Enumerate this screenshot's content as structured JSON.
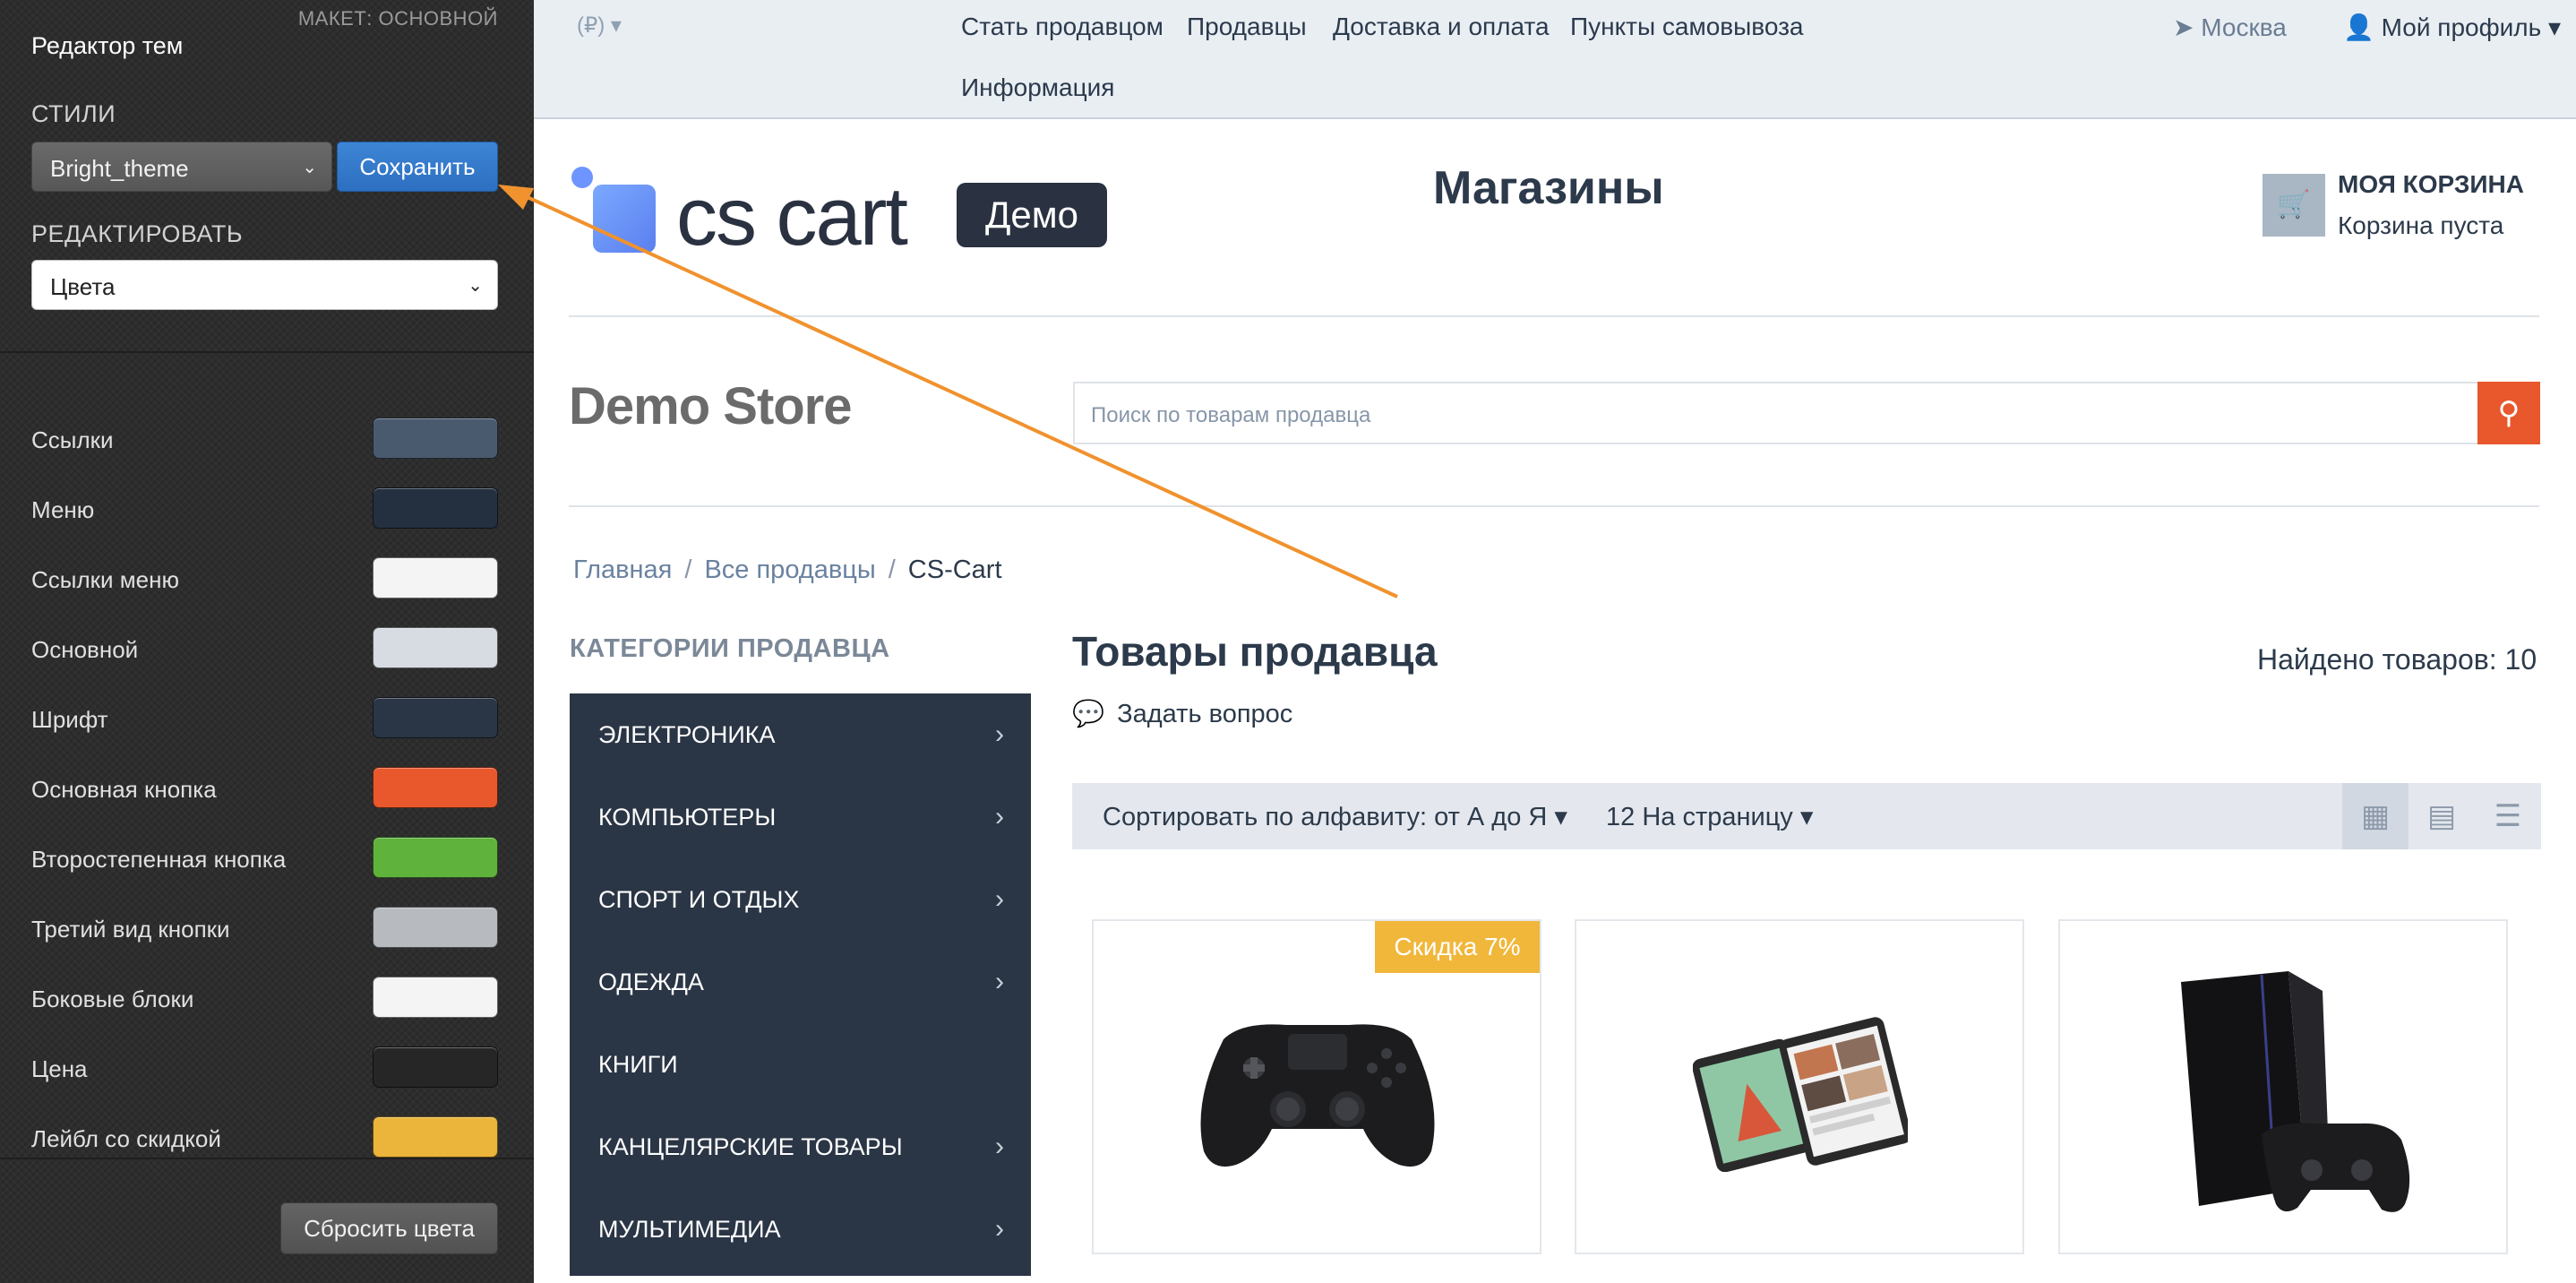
{
  "editor": {
    "layout_label": "МАКЕТ: ОСНОВНОЙ",
    "title": "Редактор тем",
    "styles_label": "СТИЛИ",
    "style_selected": "Bright_theme",
    "save_label": "Сохранить",
    "edit_label": "РЕДАКТИРОВАТЬ",
    "edit_selected": "Цвета",
    "colors": [
      {
        "label": "Ссылки",
        "color": "#4a5a6e"
      },
      {
        "label": "Меню",
        "color": "#243040"
      },
      {
        "label": "Ссылки меню",
        "color": "#f4f4f4"
      },
      {
        "label": "Основной",
        "color": "#d7dce2"
      },
      {
        "label": "Шрифт",
        "color": "#2a3545"
      },
      {
        "label": "Основная кнопка",
        "color": "#e8582c"
      },
      {
        "label": "Второстепенная кнопка",
        "color": "#5fb33c"
      },
      {
        "label": "Третий вид кнопки",
        "color": "#b7bbc0"
      },
      {
        "label": "Боковые блоки",
        "color": "#f4f4f4"
      },
      {
        "label": "Цена",
        "color": "#262626"
      },
      {
        "label": "Лейбл со скидкой",
        "color": "#eab53a"
      }
    ],
    "reset_label": "Сбросить цвета",
    "collapse_icon": "chevron-left-icon"
  },
  "topbar": {
    "currency": "(₽)",
    "nav": [
      "Стать продавцом",
      "Продавцы",
      "Доставка и оплата",
      "Пункты самовывоза",
      "Информация"
    ],
    "location": "Москва",
    "profile": "Мой профиль"
  },
  "header": {
    "logo_text": "cs cart",
    "logo_badge": "Демо",
    "page_title": "Магазины",
    "cart_title": "МОЯ КОРЗИНА",
    "cart_status": "Корзина пуста"
  },
  "store": {
    "logo_text": "Demo Store",
    "search_placeholder": "Поиск по товарам продавца"
  },
  "breadcrumb": [
    "Главная",
    "Все продавцы",
    "CS-Cart"
  ],
  "categories": {
    "heading": "КАТЕГОРИИ ПРОДАВЦА",
    "items": [
      {
        "label": "ЭЛЕКТРОНИКА",
        "has_children": true
      },
      {
        "label": "КОМПЬЮТЕРЫ",
        "has_children": true
      },
      {
        "label": "СПОРТ И ОТДЫХ",
        "has_children": true
      },
      {
        "label": "ОДЕЖДА",
        "has_children": true
      },
      {
        "label": "КНИГИ",
        "has_children": false
      },
      {
        "label": "КАНЦЕЛЯРСКИЕ ТОВАРЫ",
        "has_children": true
      },
      {
        "label": "МУЛЬТИМЕДИА",
        "has_children": true
      }
    ]
  },
  "products": {
    "title": "Товары продавца",
    "found": "Найдено товаров: 10",
    "ask": "Задать вопрос",
    "sort": "Сортировать по алфавиту: от А до Я",
    "per_page": "12 На страницу",
    "items": [
      {
        "image": "gamepad",
        "badge": "Скидка 7%"
      },
      {
        "image": "tablets",
        "badge": ""
      },
      {
        "image": "game-console",
        "badge": ""
      }
    ]
  },
  "colors": {
    "accent_blue": "#2d6fc0",
    "search_orange": "#e8582c",
    "category_bg": "#2a3545",
    "annotation_arrow": "#f0922e"
  }
}
